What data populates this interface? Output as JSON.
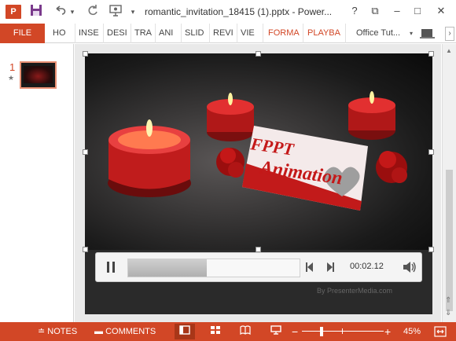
{
  "app": {
    "logo_letter": "P",
    "title": "romantic_invitation_18415 (1).pptx - Power...",
    "accent_color": "#d24726"
  },
  "quick_access": {
    "save_icon": "save-icon",
    "undo_icon": "undo-icon",
    "redo_icon": "redo-icon",
    "present_icon": "present-from-start-icon"
  },
  "window": {
    "help": "?",
    "restore": "⧉",
    "minimize": "–",
    "maximize": "□",
    "close": "✕"
  },
  "ribbon": {
    "file_label": "FILE",
    "tabs": [
      "HO",
      "INSE",
      "DESI",
      "TRA",
      "ANI",
      "SLID",
      "REVI",
      "VIE",
      "FORMA",
      "PLAYBA",
      "Office Tut..."
    ]
  },
  "thumbnails": {
    "slide_number": "1",
    "star": "★"
  },
  "slide": {
    "card_line1": "FPPT",
    "card_line2": "Animation",
    "watermark": "By PresenterMedia.com"
  },
  "video": {
    "time": "00:02.12",
    "progress": 0.46
  },
  "status": {
    "notes_label": "NOTES",
    "comments_label": "COMMENTS",
    "zoom_label": "45%",
    "zoom_level": 0.45
  }
}
